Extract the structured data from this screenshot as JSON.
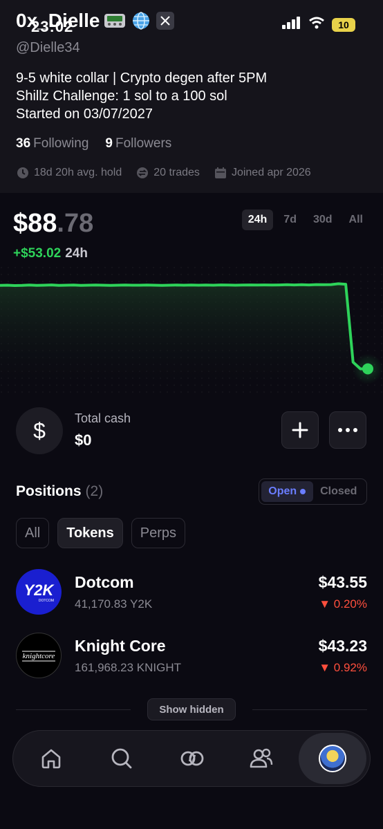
{
  "status_bar": {
    "time": "23:02",
    "battery": "10"
  },
  "profile": {
    "name": "0x_Dielle",
    "handle": "@Dielle34",
    "bio": [
      "9-5 white collar | Crypto degen after 5PM",
      "Shillz Challenge: 1 sol to a 100 sol",
      "Started on 03/07/2027"
    ],
    "following_count": "36",
    "following_label": "Following",
    "followers_count": "9",
    "followers_label": "Followers",
    "avg_hold": "18d 20h avg. hold",
    "trades": "20 trades",
    "joined": "Joined apr 2026"
  },
  "portfolio": {
    "value_main": "$88",
    "value_cents": ".78",
    "change": "+$53.02",
    "change_period": "24h",
    "ranges": [
      "24h",
      "7d",
      "30d",
      "All"
    ],
    "active_range": "24h",
    "accent_color": "#2ed35a"
  },
  "chart_data": {
    "type": "line",
    "x": [
      0,
      1,
      2,
      3,
      4,
      5,
      6,
      7,
      8,
      9,
      10,
      11,
      12,
      13,
      14,
      15,
      16,
      17,
      18,
      19,
      20,
      21,
      22,
      23,
      24,
      25,
      26,
      27,
      28,
      29,
      30,
      31,
      32,
      33,
      34,
      35,
      36,
      37,
      38,
      39,
      40,
      41,
      42,
      43,
      44,
      45,
      46,
      47,
      48,
      49,
      50
    ],
    "values": [
      88.0,
      88.1,
      87.9,
      88.0,
      88.2,
      88.0,
      88.1,
      88.3,
      88.0,
      88.1,
      88.2,
      88.0,
      88.1,
      88.2,
      88.1,
      88.0,
      88.1,
      88.2,
      88.1,
      88.1,
      88.2,
      88.1,
      88.0,
      88.1,
      88.2,
      88.1,
      88.2,
      88.1,
      88.2,
      88.1,
      88.3,
      88.2,
      88.1,
      88.2,
      88.3,
      88.2,
      88.3,
      88.2,
      88.3,
      88.4,
      88.3,
      88.4,
      88.3,
      88.5,
      88.4,
      88.5,
      89.0,
      88.7,
      40.0,
      35.8,
      35.8
    ],
    "ylim": [
      20,
      100
    ]
  },
  "cash": {
    "label": "Total cash",
    "value": "$0",
    "icon": "$"
  },
  "positions": {
    "title": "Positions",
    "count": "(2)",
    "toggle": [
      "Open",
      "Closed"
    ],
    "filters": [
      "All",
      "Tokens",
      "Perps"
    ],
    "active_filter": "Tokens",
    "items": [
      {
        "name": "Dotcom",
        "amount": "41,170.83 Y2K",
        "value": "$43.55",
        "change": "0.20%",
        "logo_text": "Y2K",
        "logo_sub": "DOTCOM",
        "logo_color": "#1a1fd0"
      },
      {
        "name": "Knight Core",
        "amount": "161,968.23 KNIGHT",
        "value": "$43.23",
        "change": "0.92%",
        "logo_text": "knightcore",
        "logo_color": "#000000"
      }
    ],
    "show_hidden": "Show hidden"
  },
  "nav": {
    "items": [
      "home-icon",
      "search-icon",
      "swap-icon",
      "people-icon",
      "avatar"
    ]
  }
}
